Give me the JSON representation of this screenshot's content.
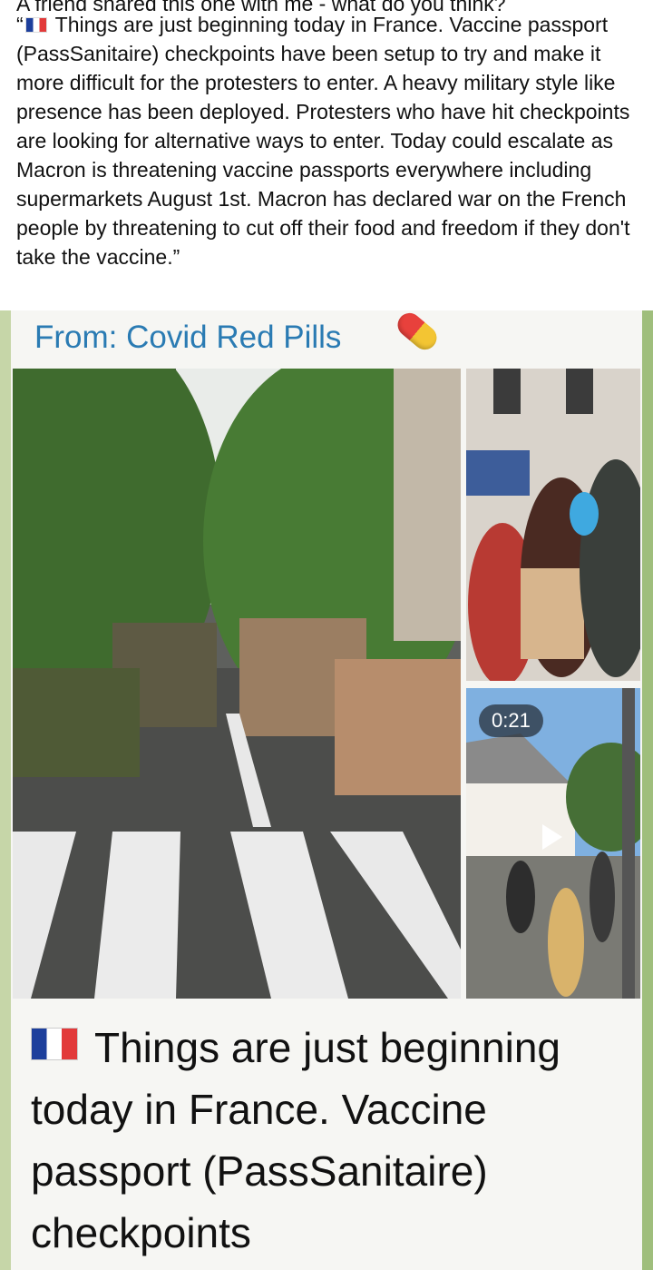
{
  "post": {
    "intro_line": "A friend shared this one with me - what do you think?",
    "text": "Things are just beginning today in France. Vaccine passport (PassSanitaire) checkpoints have been setup to try and make it more difficult for the protesters to enter. A heavy military style like presence has been deployed. Protesters who have hit checkpoints are looking for alternative ways to enter. Today could escalate as Macron is threatening vaccine passports everywhere including supermarkets August 1st. Macron has declared war on the French people by threatening to cut off their food and freedom if they don't take the vaccine.",
    "open_quote": "“",
    "close_quote": "”"
  },
  "shared_screenshot": {
    "from_label": "From:",
    "channel_name": "Covid Red Pills",
    "video_duration": "0:21",
    "caption": "Things are just beginning today in France. Vaccine passport (PassSanitaire) checkpoints"
  },
  "colors": {
    "channel_blue": "#2a7bb3",
    "frame_green": "#9fbe7c"
  },
  "icons": [
    "france-flag-icon",
    "pill-icon",
    "play-icon"
  ]
}
